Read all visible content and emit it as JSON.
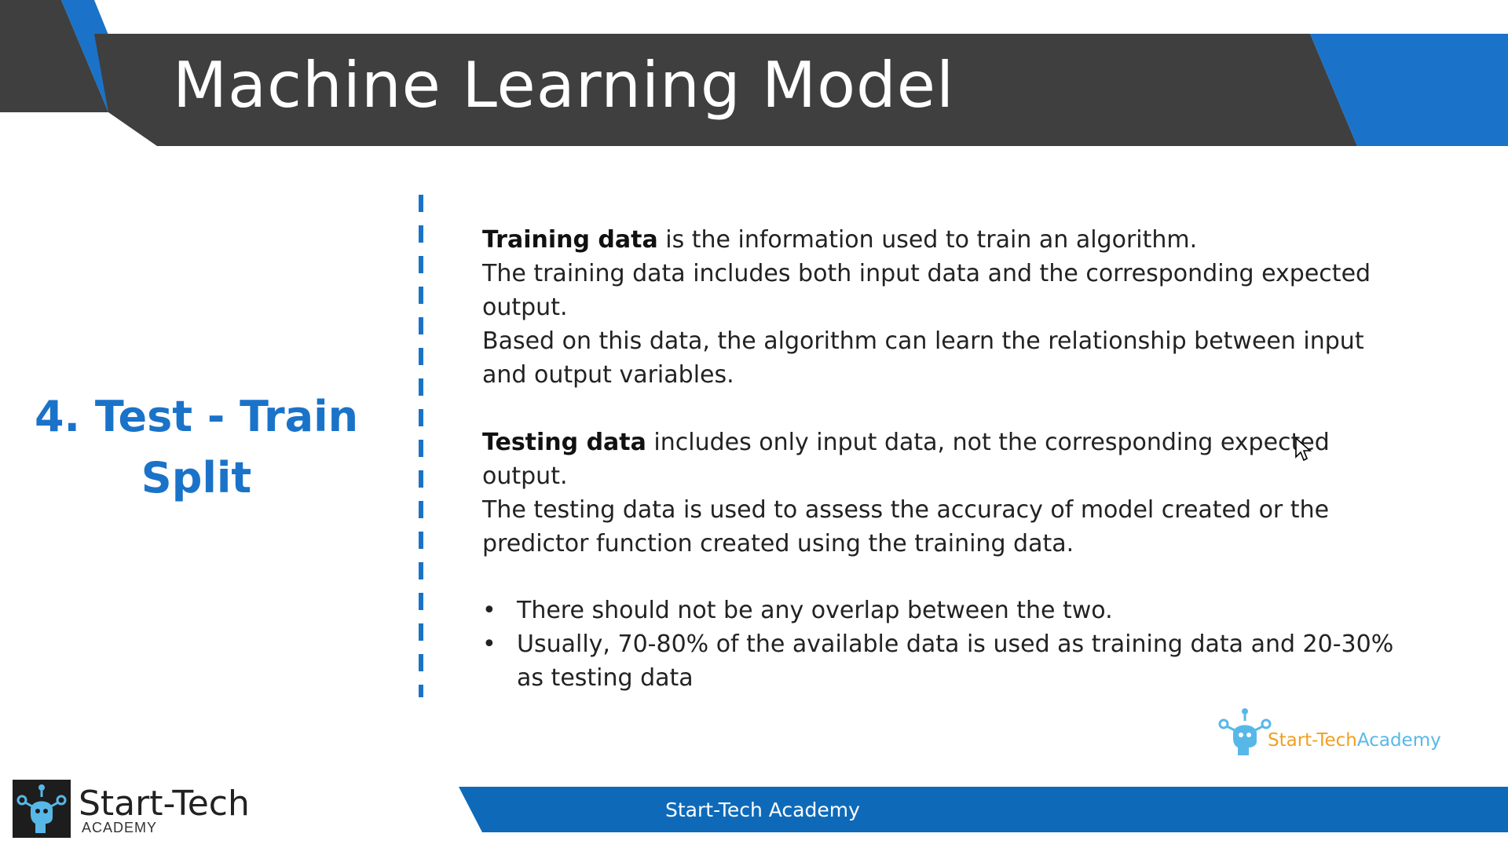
{
  "slide": {
    "title": "Machine Learning Model",
    "section_title_line1": "4. Test - Train",
    "section_title_line2": "Split"
  },
  "content": {
    "training_term": "Training data",
    "training_p1": " is the information used to train an algorithm.",
    "training_p2": "The training data includes both input data and the corresponding expected output.",
    "training_p3": "Based on this data, the algorithm can learn the relationship between input and output variables.",
    "testing_term": "Testing data",
    "testing_p1": " includes only input data, not the corresponding expected output.",
    "testing_p2": "The testing data is used to assess the accuracy of model created or the predictor function created using the training data.",
    "bullets": [
      "There should not be any overlap between the two.",
      "Usually, 70-80% of the available data is used as training data and 20-30% as testing data"
    ]
  },
  "footer": {
    "bar_text": "Start-Tech Academy",
    "logo_main": "Start-Tech",
    "logo_sub": "ACADEMY",
    "watermark_part1": "Start-Tech",
    "watermark_part2": "Academy"
  },
  "colors": {
    "banner_dark": "#3f3f3f",
    "accent_blue": "#1a73c8",
    "bar_blue": "#0e6ab9"
  },
  "icons": [
    "robot-head-logo-icon",
    "mouse-cursor-icon"
  ]
}
